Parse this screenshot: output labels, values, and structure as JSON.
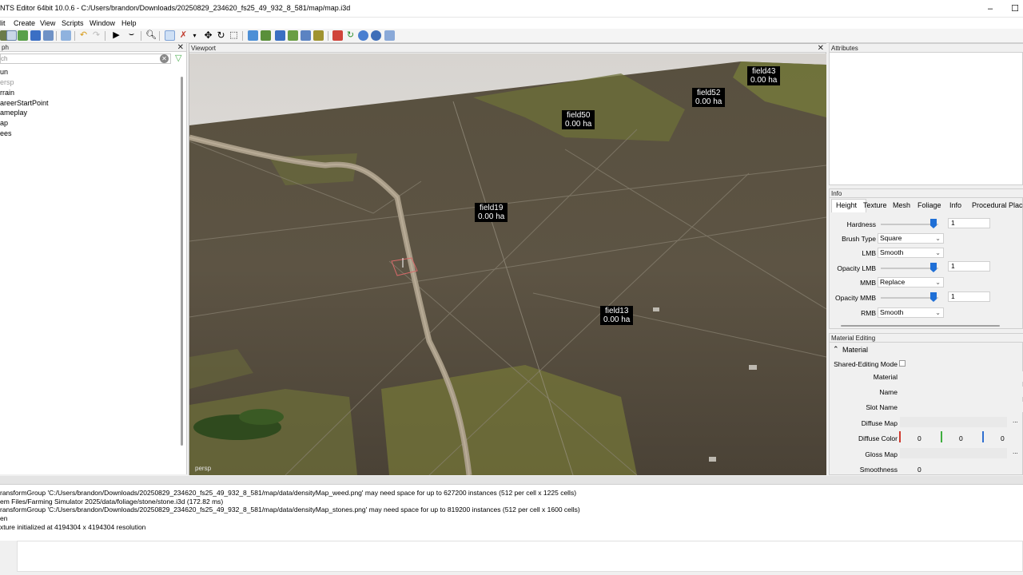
{
  "window": {
    "title": "NTS Editor 64bit 10.0.6 - C:/Users/brandon/Downloads/20250829_234620_fs25_49_932_8_581/map/map.i3d",
    "minimize": "–",
    "maximize": "☐"
  },
  "menu": [
    "lit",
    "Create",
    "View",
    "Scripts",
    "Window",
    "Help"
  ],
  "scenegraph": {
    "header": "ph",
    "search_placeholder": "ch",
    "items": [
      "un",
      "ersp",
      "rrain",
      "areerStartPoint",
      "ameplay",
      "ap",
      "ees"
    ]
  },
  "viewport": {
    "header": "Viewport",
    "camera": "persp",
    "fields": [
      {
        "name": "field43",
        "area": "0.00 ha"
      },
      {
        "name": "field52",
        "area": "0.00 ha"
      },
      {
        "name": "field50",
        "area": "0.00 ha"
      },
      {
        "name": "field19",
        "area": "0.00 ha"
      },
      {
        "name": "field13",
        "area": "0.00 ha"
      }
    ]
  },
  "attributes": {
    "header": "Attributes"
  },
  "info": {
    "header": "Info",
    "tabs": [
      "Height",
      "Texture",
      "Mesh",
      "Foliage",
      "Info",
      "Procedural Placer"
    ],
    "hardness_label": "Hardness",
    "hardness_value": "1",
    "brush_type_label": "Brush Type",
    "brush_type_value": "Square",
    "lmb_label": "LMB",
    "lmb_value": "Smooth",
    "opacity_lmb_label": "Opacity LMB",
    "opacity_lmb_value": "1",
    "mmb_label": "MMB",
    "mmb_value": "Replace",
    "opacity_mmb_label": "Opacity MMB",
    "opacity_mmb_value": "1",
    "rmb_label": "RMB",
    "rmb_value": "Smooth"
  },
  "material": {
    "header": "Material Editing",
    "section": "Material",
    "shared_mode_label": "Shared-Editing Mode",
    "material_label": "Material",
    "name_label": "Name",
    "slot_name_label": "Slot Name",
    "diffuse_map_label": "Diffuse Map",
    "diffuse_color_label": "Diffuse Color",
    "diffuse_r": "0",
    "diffuse_g": "0",
    "diffuse_b": "0",
    "gloss_map_label": "Gloss Map",
    "smoothness_label": "Smoothness",
    "smoothness_value": "0",
    "browse": "..."
  },
  "console": {
    "lines": [
      "ransformGroup 'C:/Users/brandon/Downloads/20250829_234620_fs25_49_932_8_581/map/data/densityMap_weed.png' may need space for up to 627200 instances (512 per cell x 1225 cells)",
      "em Files/Farming Simulator 2025/data/foliage/stone/stone.i3d (172.82 ms)",
      "ransformGroup 'C:/Users/brandon/Downloads/20250829_234620_fs25_49_932_8_581/map/data/densityMap_stones.png' may need space for up to 819200 instances (512 per cell x 1600 cells)",
      "en",
      "xture initialized at 4194304 x 4194304 resolution"
    ]
  },
  "colors": {
    "accent": "#1f6fd6",
    "field_label_bg": "#000000",
    "ground": "#5b5144",
    "crop": "#7c7d3f"
  }
}
